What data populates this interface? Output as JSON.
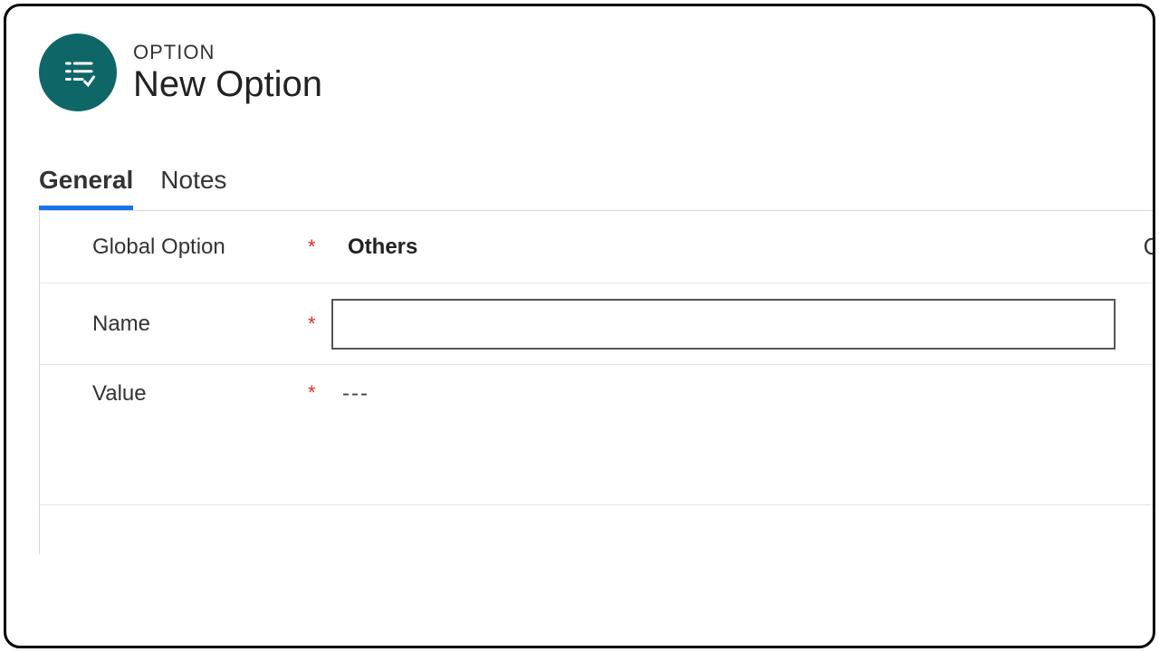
{
  "header": {
    "eyebrow": "OPTION",
    "title": "New Option"
  },
  "tabs": [
    {
      "label": "General",
      "active": true
    },
    {
      "label": "Notes",
      "active": false
    }
  ],
  "form": {
    "global_option": {
      "label": "Global Option",
      "required": "*",
      "value": "Others"
    },
    "name": {
      "label": "Name",
      "required": "*",
      "value": ""
    },
    "value_field": {
      "label": "Value",
      "required": "*",
      "value": "---"
    }
  }
}
